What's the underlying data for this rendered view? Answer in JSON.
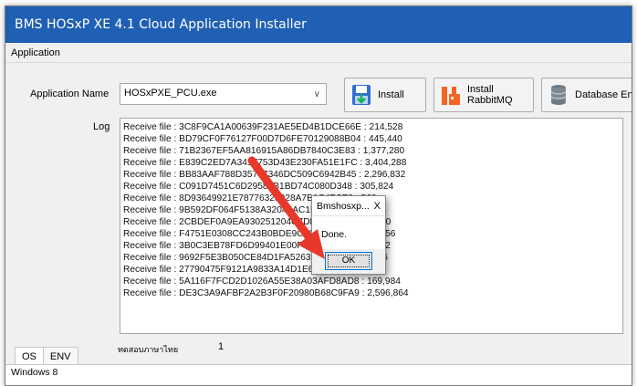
{
  "window": {
    "title": "BMS HOSxP XE 4.1 Cloud Application Installer"
  },
  "menu": {
    "items": [
      "Application"
    ]
  },
  "form": {
    "app_name_label": "Application Name",
    "app_name_value": "HOSxPXE_PCU.exe",
    "log_label": "Log"
  },
  "toolbar": {
    "install_label": "Install",
    "install_rabbitmq_label": "Install RabbitMQ",
    "database_label": "Database En"
  },
  "log": {
    "lines": [
      "Receive file : 3C8F9CA1A00639F231AE5ED4B1DCE66E : 214,528",
      "Receive file : BD79CF0F76127F00D7D6FE70129088B04 : 445,440",
      "Receive file : 71B2367EF5AA816915A86DB7840C3E83 : 1,377,280",
      "Receive file : E839C2ED7A3417753D43E230FA51E1FC : 3,404,288",
      "Receive file : BB83AAF788D35767346DC509C6942B45 : 2,296,832",
      "Receive file : C091D7451C6D29589B1BD74C080D348 : 305,824",
      "Receive file : 8D93649921E78776325928A7B1C4D9E0 : 568",
      "Receive file : 9B592DF064F5138A32049AC1E0D7F3B0 : 4,144",
      "Receive file : 2CBDEF0A9EA930251204C7D8E6B1F9A2 : 4,080",
      "Receive file : F4751E0308CC243B0BDE9C71A0F2D6E5 : 60,256",
      "Receive file : 3B0C3EB78FD6D99401E00F5A7C2B1D34 : 1,792",
      "Receive file : 9692F5E3B050CE84D1FA5263E7C9B0A8 : 3,816",
      "Receive file : 27790475F9121A9833A14D1E6F0C2B58 : 2,560",
      "Receive file : 5A116F7FCD2D1026A55E38A03AFD8AD8 : 169,984",
      "Receive file : DE3C3A9AFBF2A2B3F0F20980B68C9FA9 : 2,596,864"
    ]
  },
  "footer": {
    "count_label": "ทดสอบภาษาไทย",
    "count_value": "1",
    "tabs": [
      "OS",
      "ENV"
    ],
    "tab_content": "Windows 8"
  },
  "dialog": {
    "title": "Bmshosxp...",
    "close": "X",
    "message": "Done.",
    "ok_label": "OK"
  },
  "colors": {
    "titlebar": "#1f5fb4",
    "arrow": "#e8382a"
  }
}
